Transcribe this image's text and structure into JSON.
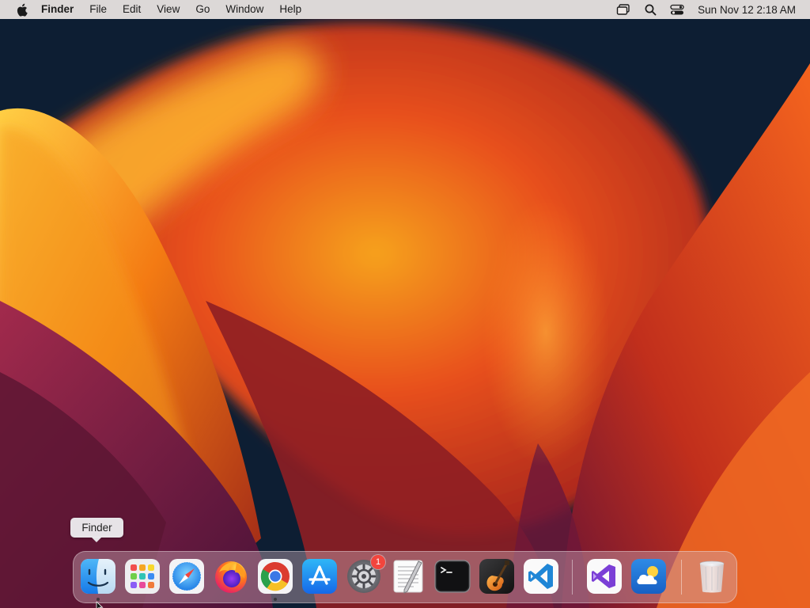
{
  "menubar": {
    "app_name": "Finder",
    "menus": [
      "File",
      "Edit",
      "View",
      "Go",
      "Window",
      "Help"
    ],
    "status_icons": [
      "screen-mirroring-icon",
      "spotlight-search-icon",
      "control-center-icon"
    ],
    "clock": "Sun Nov 12  2:18 AM"
  },
  "tooltip": {
    "text": "Finder"
  },
  "dock": {
    "apps": [
      {
        "name": "Finder",
        "icon": "finder-icon",
        "running": true
      },
      {
        "name": "Launchpad",
        "icon": "launchpad-icon",
        "running": false
      },
      {
        "name": "Safari",
        "icon": "safari-icon",
        "running": false
      },
      {
        "name": "Firefox",
        "icon": "firefox-icon",
        "running": false
      },
      {
        "name": "Google Chrome",
        "icon": "chrome-icon",
        "running": true
      },
      {
        "name": "App Store",
        "icon": "app-store-icon",
        "running": false
      },
      {
        "name": "System Settings",
        "icon": "system-settings-icon",
        "running": false,
        "badge": "1"
      },
      {
        "name": "TextEdit",
        "icon": "textedit-icon",
        "running": false
      },
      {
        "name": "Terminal",
        "icon": "terminal-icon",
        "running": false
      },
      {
        "name": "GarageBand",
        "icon": "garageband-icon",
        "running": false
      },
      {
        "name": "Visual Studio Code",
        "icon": "vscode-icon",
        "running": false
      },
      {
        "name": "Visual Studio",
        "icon": "visual-studio-icon",
        "running": false
      },
      {
        "name": "Weather",
        "icon": "weather-icon",
        "running": false
      },
      {
        "name": "Trash",
        "icon": "trash-icon",
        "running": false
      }
    ]
  },
  "colors": {
    "wallpaper_dark": "#0d1e33",
    "wallpaper_orange": "#f07a18",
    "wallpaper_magenta": "#7a1d46",
    "badge_red": "#f2453d"
  }
}
